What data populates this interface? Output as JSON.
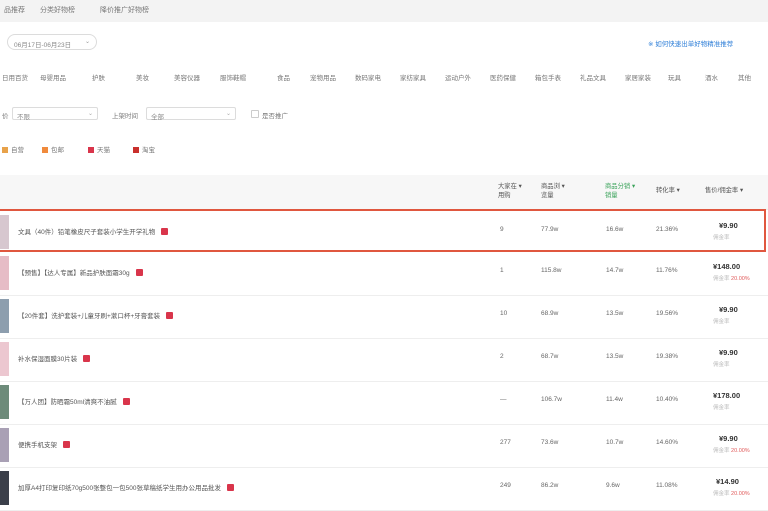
{
  "tabs": [
    "品推荐",
    "分类好物榜",
    "降价推广好物榜"
  ],
  "date_range": "06月17日-06月23日",
  "top_link": "※ 如何快速出单好物精准推荐",
  "categories": [
    "日用百货",
    "母婴用品",
    "护肤",
    "美妆",
    "美容仪器",
    "服饰鞋帽",
    "食品",
    "宠物用品",
    "数码家电",
    "家纺家具",
    "运动户外",
    "医药保健",
    "箱包手表",
    "礼品文具",
    "家居家装",
    "玩具",
    "酒水",
    "其他"
  ],
  "filters": {
    "label1": "价",
    "value1": "不限",
    "label2": "上架时间",
    "value2": "全部",
    "check_label": "是否推广"
  },
  "legend": [
    {
      "label": "自营",
      "color": "#e8a24a"
    },
    {
      "label": "包邮",
      "color": "#f08a3c"
    },
    {
      "label": "天猫",
      "color": "#d9354b"
    },
    {
      "label": "淘宝",
      "color": "#c9302c"
    }
  ],
  "headers": {
    "col1": [
      "大家在",
      "用购"
    ],
    "col2": [
      "商品浏",
      "览量"
    ],
    "col3": [
      "商品分销",
      "销量"
    ],
    "col4": "转化率",
    "col5": "售价/佣金率"
  },
  "rows": [
    {
      "name": "文具（40件）铅笔橡皮尺子套装小学生开学礼物",
      "c1": "9",
      "c2": "77.9w",
      "c3": "16.6w",
      "c4": "21.36%",
      "price": "¥9.90",
      "sub_text": "佣金率",
      "sub_red": "",
      "thumb": "#d7c7cf"
    },
    {
      "name": "【预售】【达人专属】新品护肤面霜30g",
      "c1": "1",
      "c2": "115.8w",
      "c3": "14.7w",
      "c4": "11.76%",
      "price": "¥148.00",
      "sub_text": "佣金率",
      "sub_red": "20.00%",
      "thumb": "#e6bcc6"
    },
    {
      "name": "【20件套】洗护套装+儿童牙刷+漱口杯+牙膏套装",
      "c1": "10",
      "c2": "68.9w",
      "c3": "13.5w",
      "c4": "19.56%",
      "price": "¥9.90",
      "sub_text": "佣金率",
      "sub_red": "",
      "thumb": "#8d9eae"
    },
    {
      "name": "补水保湿面膜30片装",
      "c1": "2",
      "c2": "68.7w",
      "c3": "13.5w",
      "c4": "19.38%",
      "price": "¥9.90",
      "sub_text": "佣金率",
      "sub_red": "",
      "thumb": "#ecc7d0"
    },
    {
      "name": "【万人团】防晒霜50ml清爽不油腻",
      "c1": "—",
      "c2": "106.7w",
      "c3": "11.4w",
      "c4": "10.40%",
      "price": "¥178.00",
      "sub_text": "佣金率",
      "sub_red": "",
      "thumb": "#6d8b7a"
    },
    {
      "name": "便携手机支架",
      "c1": "277",
      "c2": "73.6w",
      "c3": "10.7w",
      "c4": "14.60%",
      "price": "¥9.90",
      "sub_text": "佣金率",
      "sub_red": "20.00%",
      "thumb": "#a9a0b5"
    },
    {
      "name": "加厚A4打印复印纸70g500张整包一包500张草稿纸学生用办公用品批发",
      "c1": "249",
      "c2": "86.2w",
      "c3": "9.6w",
      "c4": "11.08%",
      "price": "¥14.90",
      "sub_text": "佣金率",
      "sub_red": "20.00%",
      "thumb": "#3b3f4a"
    }
  ]
}
